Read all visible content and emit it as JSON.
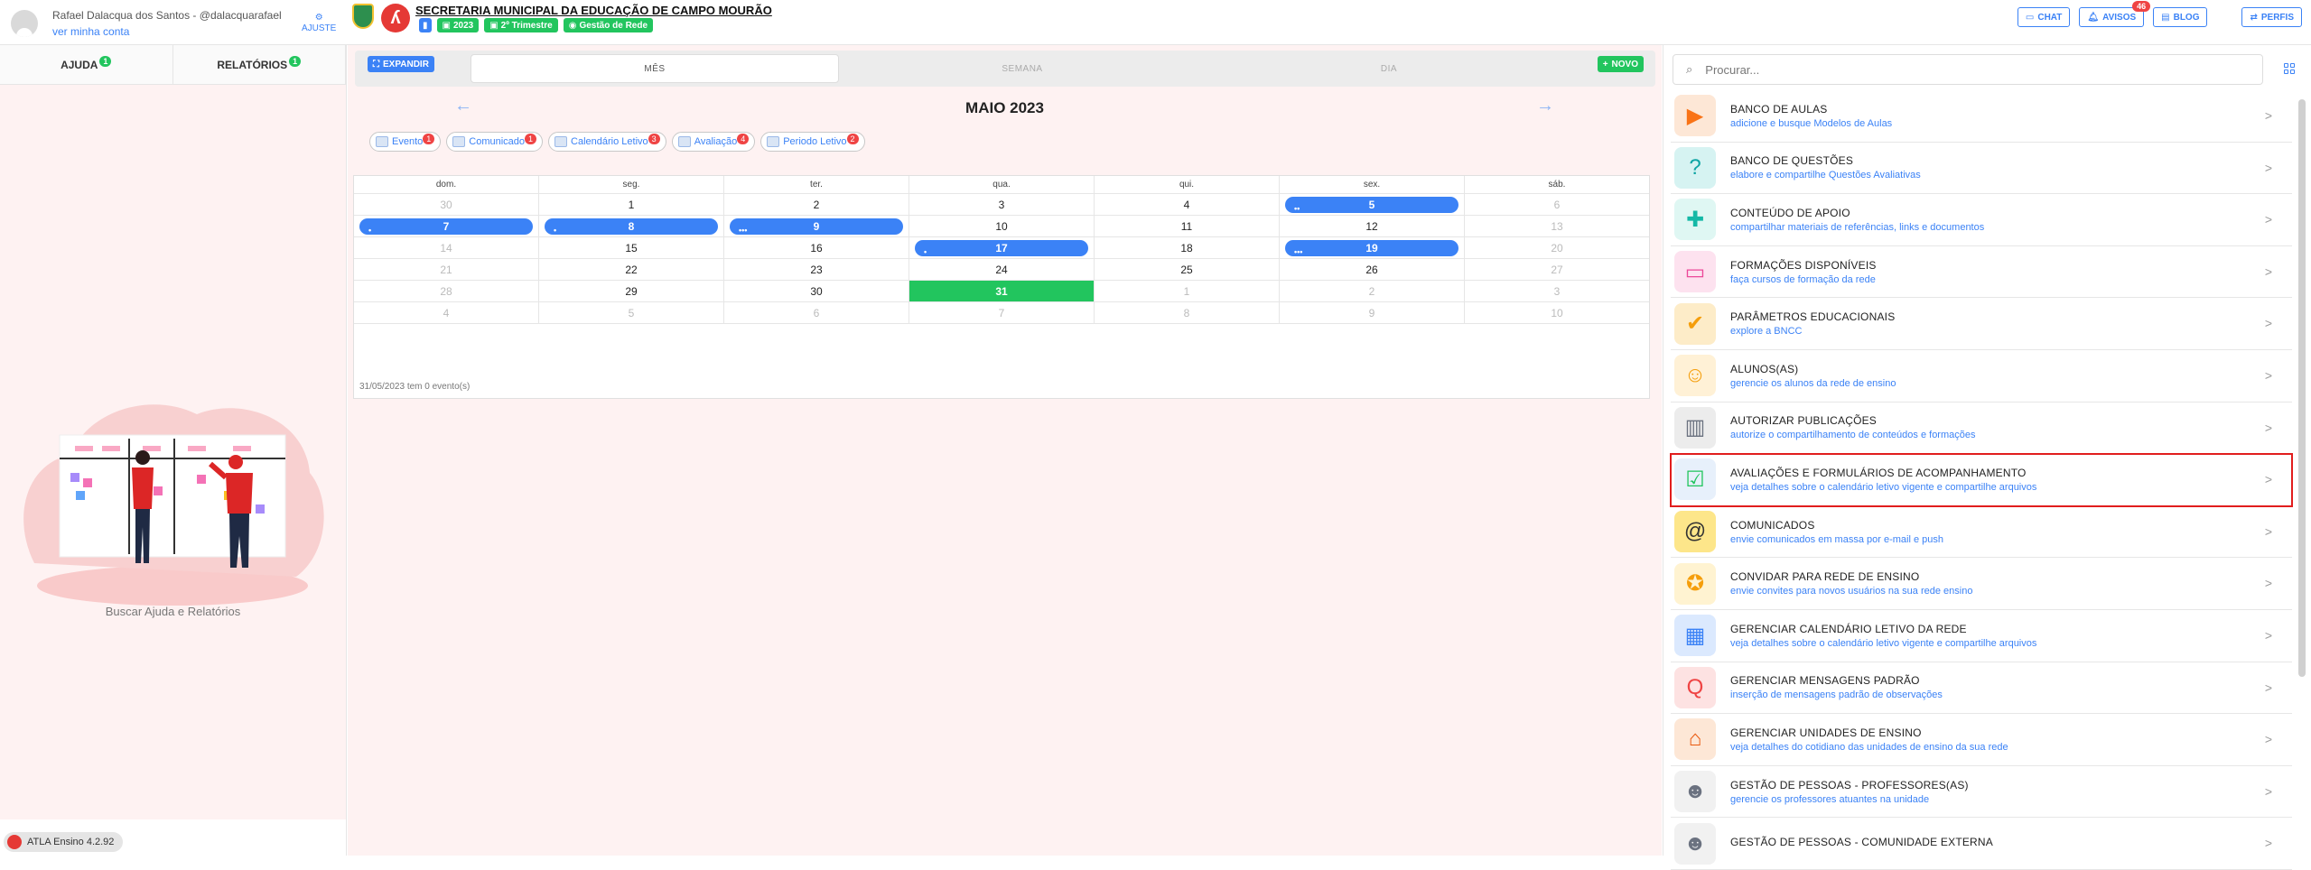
{
  "user": {
    "name": "Rafael Dalacqua dos Santos - @dalacquarafael",
    "link": "ver minha conta",
    "ajuste": "AJUSTE"
  },
  "org": {
    "title": "SECRETARIA MUNICIPAL DA EDUCAÇÃO DE CAMPO MOURÃO",
    "chips": [
      "2023",
      "2º Trimestre",
      "Gestão de Rede"
    ]
  },
  "topbar": {
    "chat": "CHAT",
    "avisos": "AVISOS",
    "avisos_count": "46",
    "blog": "BLOG",
    "perfis": "PERFIS"
  },
  "left": {
    "tabs": [
      {
        "label": "AJUDA",
        "count": "1"
      },
      {
        "label": "RELATÓRIOS",
        "count": "1"
      }
    ],
    "caption": "Buscar Ajuda e Relatórios",
    "version": "ATLA Ensino 4.2.92"
  },
  "calendar": {
    "expand": "EXPANDIR",
    "novo": "NOVO",
    "views": [
      "MÊS",
      "SEMANA",
      "DIA"
    ],
    "month": "MAIO 2023",
    "legend": [
      {
        "label": "Evento",
        "count": "1"
      },
      {
        "label": "Comunicado",
        "count": "1"
      },
      {
        "label": "Calendário Letivo",
        "count": "3"
      },
      {
        "label": "Avaliação",
        "count": "4"
      },
      {
        "label": "Periodo Letivo",
        "count": "2"
      }
    ],
    "weekdays": [
      "dom.",
      "seg.",
      "ter.",
      "qua.",
      "qui.",
      "sex.",
      "sáb."
    ],
    "weeks": [
      [
        {
          "d": "30",
          "o": 1
        },
        {
          "d": "1"
        },
        {
          "d": "2"
        },
        {
          "d": "3"
        },
        {
          "d": "4"
        },
        {
          "d": "5",
          "ev": "••"
        },
        {
          "d": "6",
          "o": 1
        }
      ],
      [
        {
          "d": "7",
          "ev": "•"
        },
        {
          "d": "8",
          "ev": "•"
        },
        {
          "d": "9",
          "ev": "•••"
        },
        {
          "d": "10"
        },
        {
          "d": "11"
        },
        {
          "d": "12"
        },
        {
          "d": "13",
          "o": 1
        }
      ],
      [
        {
          "d": "14",
          "o": 1
        },
        {
          "d": "15"
        },
        {
          "d": "16"
        },
        {
          "d": "17",
          "ev": "•"
        },
        {
          "d": "18"
        },
        {
          "d": "19",
          "ev": "•••"
        },
        {
          "d": "20",
          "o": 1
        }
      ],
      [
        {
          "d": "21",
          "o": 1
        },
        {
          "d": "22"
        },
        {
          "d": "23"
        },
        {
          "d": "24"
        },
        {
          "d": "25"
        },
        {
          "d": "26"
        },
        {
          "d": "27",
          "o": 1
        }
      ],
      [
        {
          "d": "28",
          "o": 1
        },
        {
          "d": "29"
        },
        {
          "d": "30"
        },
        {
          "d": "31",
          "t": 1
        },
        {
          "d": "1",
          "o": 1
        },
        {
          "d": "2",
          "o": 1
        },
        {
          "d": "3",
          "o": 1
        }
      ],
      [
        {
          "d": "4",
          "o": 1
        },
        {
          "d": "5",
          "o": 1
        },
        {
          "d": "6",
          "o": 1
        },
        {
          "d": "7",
          "o": 1
        },
        {
          "d": "8",
          "o": 1
        },
        {
          "d": "9",
          "o": 1
        },
        {
          "d": "10",
          "o": 1
        }
      ]
    ],
    "note": "31/05/2023 tem 0 evento(s)"
  },
  "right": {
    "search_placeholder": "Procurar...",
    "items": [
      {
        "title": "BANCO DE AULAS",
        "sub": "adicione e busque Modelos de Aulas",
        "icon": "▶",
        "color": "#f97316",
        "bg": "#fde7d6"
      },
      {
        "title": "BANCO DE QUESTÕES",
        "sub": "elabore e compartilhe Questões Avaliativas",
        "icon": "?",
        "color": "#0ea5a4",
        "bg": "#d6f3f2"
      },
      {
        "title": "CONTEÚDO DE APOIO",
        "sub": "compartilhar materiais de referências, links e documentos",
        "icon": "✚",
        "color": "#14b8a6",
        "bg": "#dff7f3"
      },
      {
        "title": "FORMAÇÕES DISPONÍVEIS",
        "sub": "faça cursos de formação da rede",
        "icon": "▭",
        "color": "#ec4899",
        "bg": "#fde2ef"
      },
      {
        "title": "PARÂMETROS EDUCACIONAIS",
        "sub": "explore a BNCC",
        "icon": "✔",
        "color": "#f59e0b",
        "bg": "#fdecc8"
      },
      {
        "title": "ALUNOS(AS)",
        "sub": "gerencie os alunos da rede de ensino",
        "icon": "☺",
        "color": "#f59e0b",
        "bg": "#fff1d6"
      },
      {
        "title": "AUTORIZAR PUBLICAÇÕES",
        "sub": "autorize o compartilhamento de conteúdos e formações",
        "icon": "▥",
        "color": "#6b7280",
        "bg": "#ececec"
      },
      {
        "title": "AVALIAÇÕES E FORMULÁRIOS DE ACOMPANHAMENTO",
        "sub": "veja detalhes sobre o calendário letivo vigente e compartilhe arquivos",
        "icon": "☑",
        "color": "#22c55e",
        "bg": "#e7f0fb",
        "sel": true
      },
      {
        "title": "COMUNICADOS",
        "sub": "envie comunicados em massa por e-mail e push",
        "icon": "@",
        "color": "#333",
        "bg": "#fde68a"
      },
      {
        "title": "CONVIDAR PARA REDE DE ENSINO",
        "sub": "envie convites para novos usuários na sua rede ensino",
        "icon": "✪",
        "color": "#f59e0b",
        "bg": "#fff3d1"
      },
      {
        "title": "GERENCIAR CALENDÁRIO LETIVO DA REDE",
        "sub": "veja detalhes sobre o calendário letivo vigente e compartilhe arquivos",
        "icon": "▦",
        "color": "#3b82f6",
        "bg": "#dbe9fe"
      },
      {
        "title": "GERENCIAR MENSAGENS PADRÃO",
        "sub": "inserção de mensagens padrão de observações",
        "icon": "Q",
        "color": "#ef4444",
        "bg": "#fde2e2"
      },
      {
        "title": "GERENCIAR UNIDADES DE ENSINO",
        "sub": "veja detalhes do cotidiano das unidades de ensino da sua rede",
        "icon": "⌂",
        "color": "#ea580c",
        "bg": "#fde7d6"
      },
      {
        "title": "GESTÃO DE PESSOAS - PROFESSORES(AS)",
        "sub": "gerencie os professores atuantes na unidade",
        "icon": "☻",
        "color": "#6b7280",
        "bg": "#f1f1f1"
      },
      {
        "title": "GESTÃO DE PESSOAS - COMUNIDADE EXTERNA",
        "sub": "",
        "icon": "☻",
        "color": "#6b7280",
        "bg": "#f1f1f1"
      }
    ]
  }
}
